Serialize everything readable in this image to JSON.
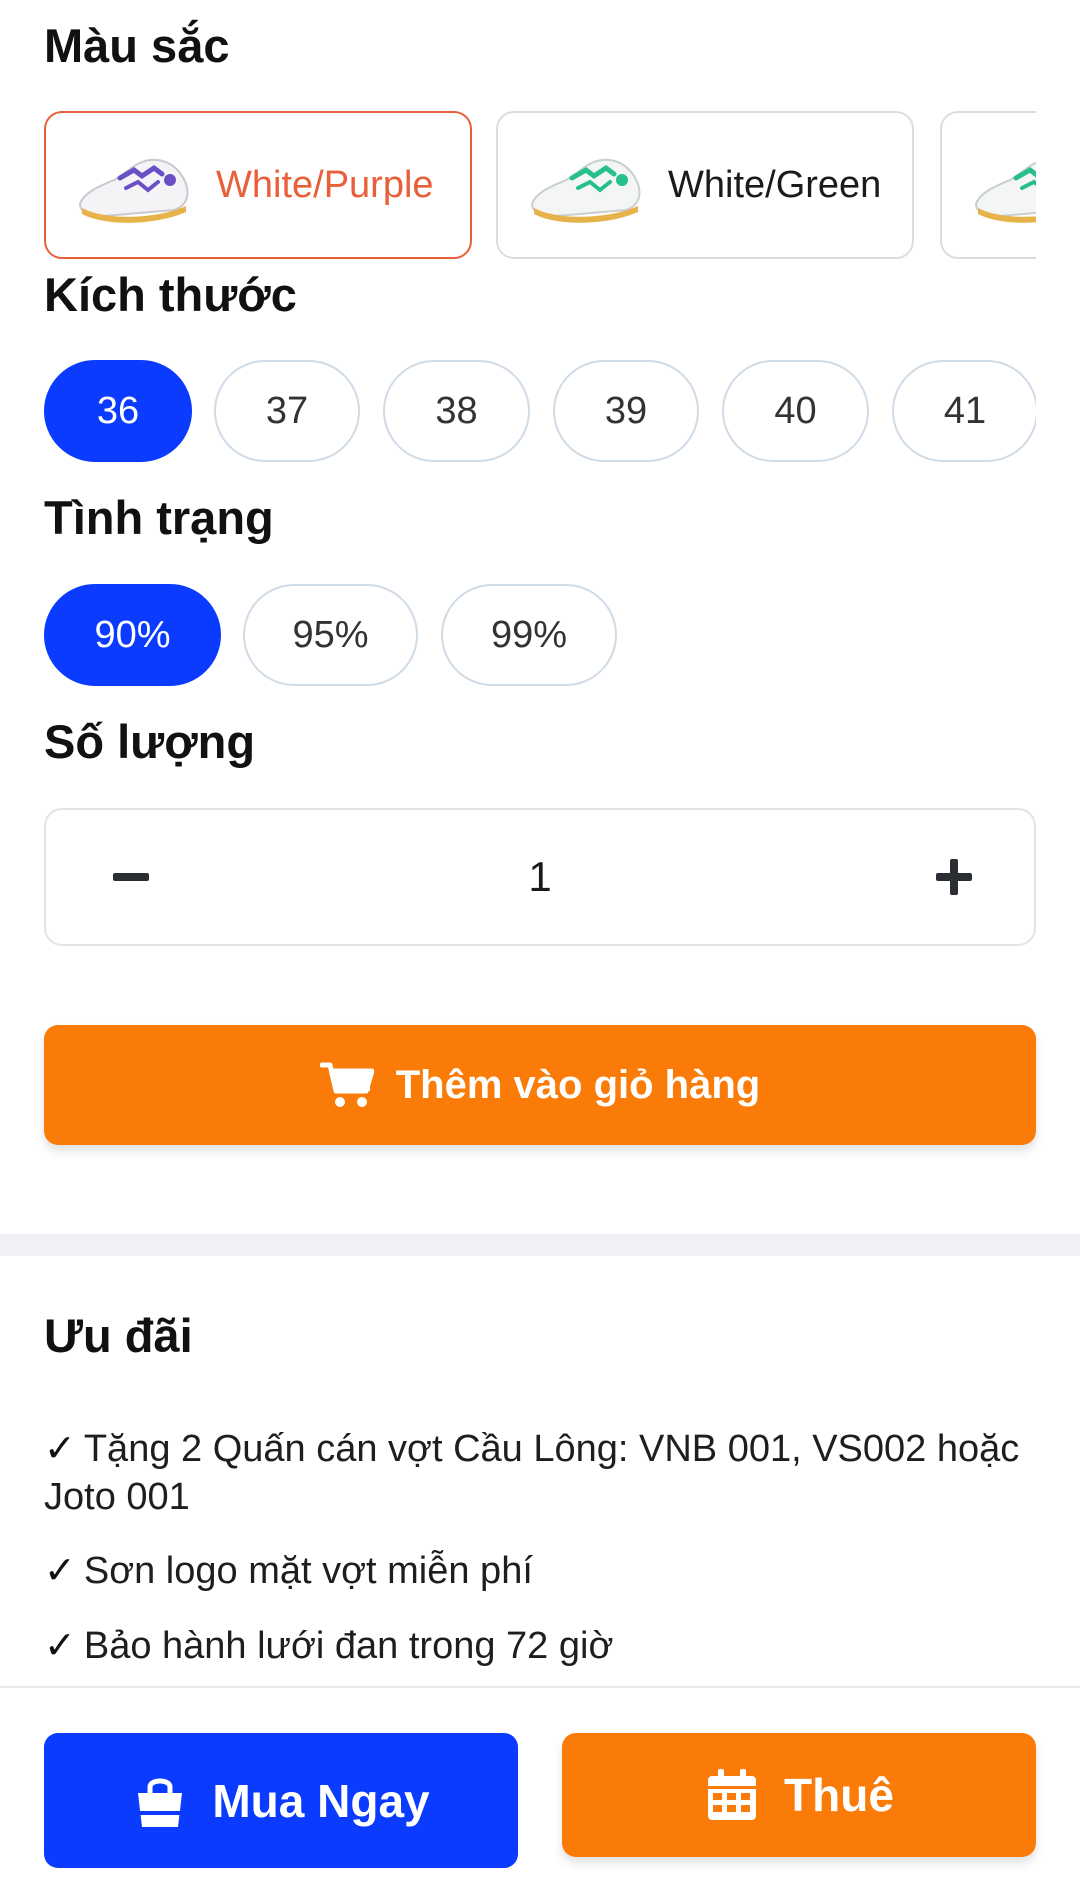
{
  "color_section": {
    "title": "Màu sắc",
    "options": [
      {
        "label": "White/Purple",
        "accent": "#6a4fc7",
        "selected": true
      },
      {
        "label": "White/Green",
        "accent": "#27c08a",
        "selected": false
      },
      {
        "label": "",
        "accent": "#27c08a",
        "selected": false
      }
    ],
    "selected_color": "#e8603a"
  },
  "size_section": {
    "title": "Kích thước",
    "sizes": [
      "36",
      "37",
      "38",
      "39",
      "40",
      "41"
    ],
    "active": "36"
  },
  "condition_section": {
    "title": "Tình trạng",
    "options": [
      "90%",
      "95%",
      "99%"
    ],
    "active": "90%"
  },
  "quantity_section": {
    "title": "Số lượng",
    "value": "1",
    "minus_icon": "minus-icon",
    "plus_icon": "plus-icon"
  },
  "add_to_cart": {
    "label": "Thêm vào giỏ hàng",
    "icon": "cart-icon",
    "color": "#fa7b07"
  },
  "offers": {
    "title": "Ưu đãi",
    "check": "✓",
    "items": [
      "Tặng 2 Quấn cán vợt Cầu Lông: VNB 001, VS002 hoặc Joto 001",
      "Sơn logo mặt vợt miễn phí",
      "Bảo hành lưới đan trong 72 giờ"
    ]
  },
  "bottom_bar": {
    "buy_label": "Mua Ngay",
    "buy_icon": "shopping-bag-icon",
    "buy_color": "#0a3bff",
    "rent_label": "Thuê",
    "rent_icon": "calendar-icon",
    "rent_color": "#fa7b07"
  }
}
